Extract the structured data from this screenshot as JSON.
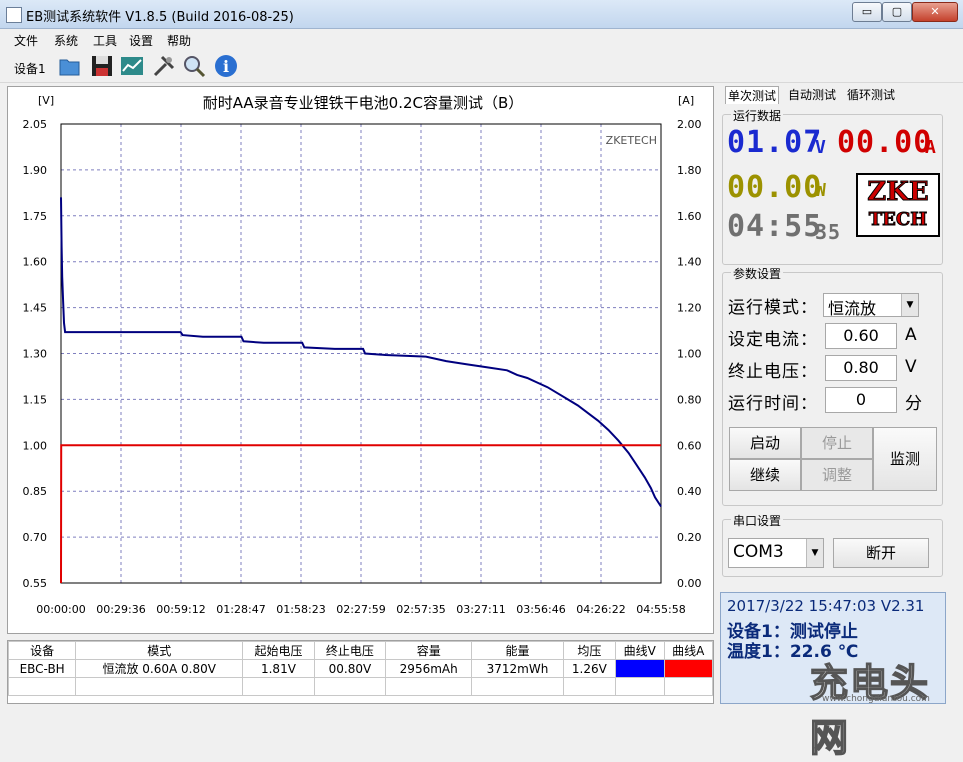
{
  "window": {
    "title": "EB测试系统软件 V1.8.5 (Build 2016-08-25)",
    "minimize": "▭",
    "maximize": "▢",
    "close": "✕"
  },
  "menu": [
    "文件",
    "系统",
    "工具",
    "设置",
    "帮助"
  ],
  "toolbar": {
    "device_tab": "设备1",
    "icons": [
      "open-folder-icon",
      "save-icon",
      "chart-icon",
      "tools-icon",
      "search-icon",
      "info-icon"
    ]
  },
  "chart_data": {
    "type": "line",
    "title": "耐时AA录音专业锂铁干电池0.2C容量测试（B）",
    "watermark": "ZKETECH",
    "left_unit": "[V]",
    "right_unit": "[A]",
    "y_ticks": [
      "0.55",
      "0.70",
      "0.85",
      "1.00",
      "1.15",
      "1.30",
      "1.45",
      "1.60",
      "1.75",
      "1.90",
      "2.05"
    ],
    "y2_ticks": [
      "0.00",
      "0.20",
      "0.40",
      "0.60",
      "0.80",
      "1.00",
      "1.20",
      "1.40",
      "1.60",
      "1.80",
      "2.00"
    ],
    "x_ticks": [
      "00:00:00",
      "00:29:36",
      "00:59:12",
      "01:28:47",
      "01:58:23",
      "02:27:59",
      "02:57:35",
      "03:27:11",
      "03:56:46",
      "04:26:22",
      "04:55:58"
    ],
    "ylim": [
      0.55,
      2.05
    ],
    "y2lim": [
      0.0,
      2.0
    ],
    "xlim": [
      0,
      295.97
    ],
    "grid": true,
    "series": [
      {
        "color": "#00007f",
        "axis": "left",
        "x": [
          0,
          0.3,
          0.6,
          1,
          1.5,
          2,
          5,
          20,
          40,
          59,
          60,
          70,
          89,
          90,
          100,
          119,
          120,
          135,
          149,
          150,
          160,
          180,
          190,
          200,
          210,
          220,
          225,
          230,
          235,
          240,
          245,
          250,
          255,
          260,
          265,
          270,
          275,
          280,
          285,
          288,
          291,
          293,
          295.97
        ],
        "y": [
          1.81,
          1.65,
          1.55,
          1.48,
          1.4,
          1.37,
          1.37,
          1.37,
          1.37,
          1.37,
          1.36,
          1.355,
          1.355,
          1.34,
          1.335,
          1.335,
          1.32,
          1.315,
          1.315,
          1.3,
          1.295,
          1.29,
          1.275,
          1.265,
          1.255,
          1.245,
          1.23,
          1.22,
          1.205,
          1.19,
          1.17,
          1.15,
          1.13,
          1.105,
          1.08,
          1.05,
          1.015,
          0.975,
          0.925,
          0.895,
          0.86,
          0.83,
          0.8
        ]
      },
      {
        "color": "#e00000",
        "axis": "right",
        "x": [
          0,
          0.1,
          295.97
        ],
        "y": [
          0.0,
          0.6,
          0.6
        ]
      }
    ]
  },
  "table": {
    "headers": [
      "设备",
      "模式",
      "起始电压",
      "终止电压",
      "容量",
      "能量",
      "均压",
      "曲线V",
      "曲线A"
    ],
    "row": [
      "EBC-BH",
      "恒流放  0.60A  0.80V",
      "1.81V",
      "00.80V",
      "2956mAh",
      "3712mWh",
      "1.26V",
      "",
      ""
    ],
    "curve_v_color": "#0000ff",
    "curve_a_color": "#ff0000"
  },
  "tabs": [
    "单次测试",
    "自动测试",
    "循环测试"
  ],
  "run_data": {
    "caption": "运行数据",
    "voltage": "01.07",
    "voltage_unit": "V",
    "voltage_color": "#1a2ad0",
    "current": "00.00",
    "current_unit": "A",
    "current_color": "#d00000",
    "power": "00.00",
    "power_unit": "W",
    "power_color": "#9c9200",
    "time": "04:55",
    "time_sec": "35",
    "time_color": "#606060",
    "logo_line1": "ZKE",
    "logo_line2": "TECH"
  },
  "params": {
    "caption": "参数设置",
    "mode_label": "运行模式：",
    "mode_value": "恒流放",
    "current_label": "设定电流：",
    "current_value": "0.60",
    "current_unit": "A",
    "voltage_label": "终止电压：",
    "voltage_value": "0.80",
    "voltage_unit": "V",
    "time_label": "运行时间：",
    "time_value": "0",
    "time_unit": "分",
    "start": "启动",
    "stop": "停止",
    "continue": "继续",
    "adjust": "调整",
    "monitor": "监测"
  },
  "serial": {
    "caption": "串口设置",
    "port": "COM3",
    "disconnect": "断开"
  },
  "status": {
    "line1": "2017/3/22 15:47:03  V2.31",
    "line2": "设备1：测试停止",
    "line3": "温度1：22.6 ℃"
  },
  "watermark": {
    "brand": "充电头网",
    "url": "www.chongdiantou.com"
  }
}
